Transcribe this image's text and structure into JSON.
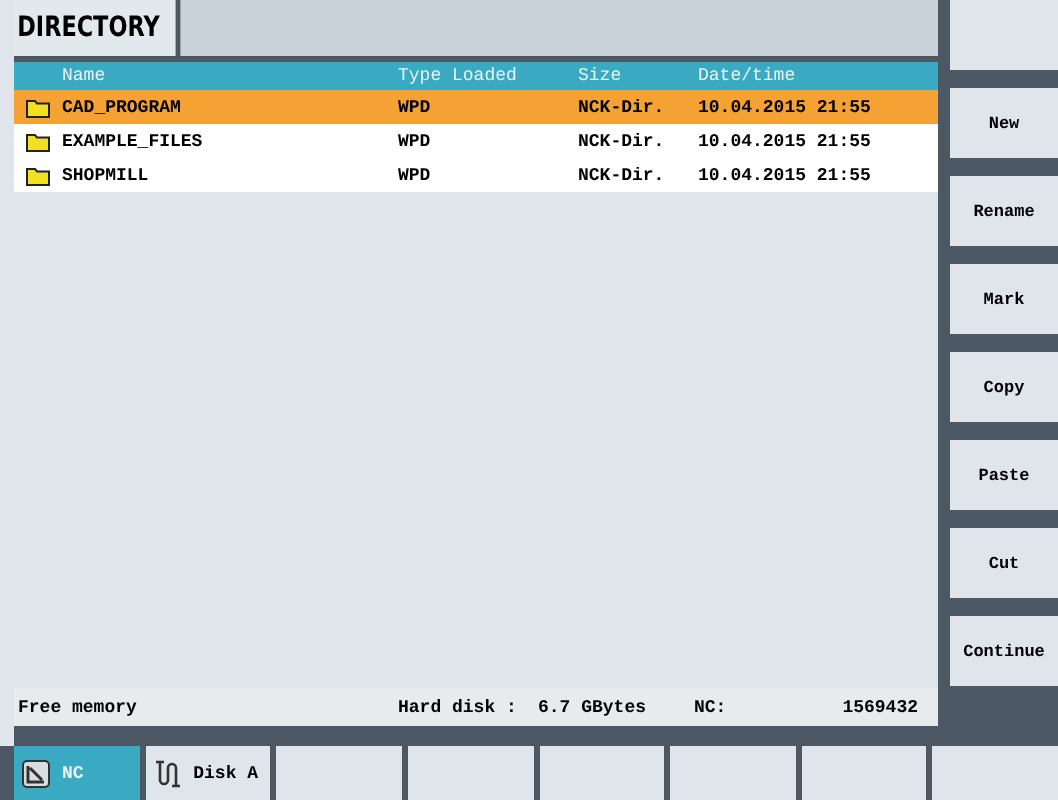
{
  "header": {
    "title": "DIRECTORY"
  },
  "table": {
    "columns": [
      "Name",
      "Type Loaded",
      "Size",
      "Date/time"
    ],
    "rows": [
      {
        "name": "CAD_PROGRAM",
        "type": "WPD",
        "size": "NCK-Dir.",
        "date": "10.04.2015 21:55",
        "selected": true
      },
      {
        "name": "EXAMPLE_FILES",
        "type": "WPD",
        "size": "NCK-Dir.",
        "date": "10.04.2015 21:55",
        "selected": false
      },
      {
        "name": "SHOPMILL",
        "type": "WPD",
        "size": "NCK-Dir.",
        "date": "10.04.2015 21:55",
        "selected": false
      }
    ]
  },
  "status_bar": {
    "label": "Free memory",
    "disk_label": "Hard disk :",
    "disk_value": "6.7 GBytes",
    "nc_label": "NC:",
    "nc_value": "1569432"
  },
  "vertical_softkeys": [
    {
      "kind": "blank"
    },
    {
      "kind": "button",
      "label": "New"
    },
    {
      "kind": "button",
      "label": "Rename"
    },
    {
      "kind": "button",
      "label": "Mark"
    },
    {
      "kind": "button",
      "label": "Copy"
    },
    {
      "kind": "button",
      "label": "Paste"
    },
    {
      "kind": "button",
      "label": "Cut"
    },
    {
      "kind": "button",
      "label": "Continue"
    }
  ],
  "horizontal_softkeys": [
    {
      "kind": "nc",
      "label": "NC",
      "selected": true
    },
    {
      "kind": "disk",
      "label": "Disk A",
      "selected": false
    },
    {
      "kind": "blank",
      "selected": false
    },
    {
      "kind": "blank",
      "selected": false
    },
    {
      "kind": "blank",
      "selected": false
    },
    {
      "kind": "blank",
      "selected": false
    },
    {
      "kind": "blank",
      "selected": false
    },
    {
      "kind": "blank",
      "selected": false
    }
  ]
}
